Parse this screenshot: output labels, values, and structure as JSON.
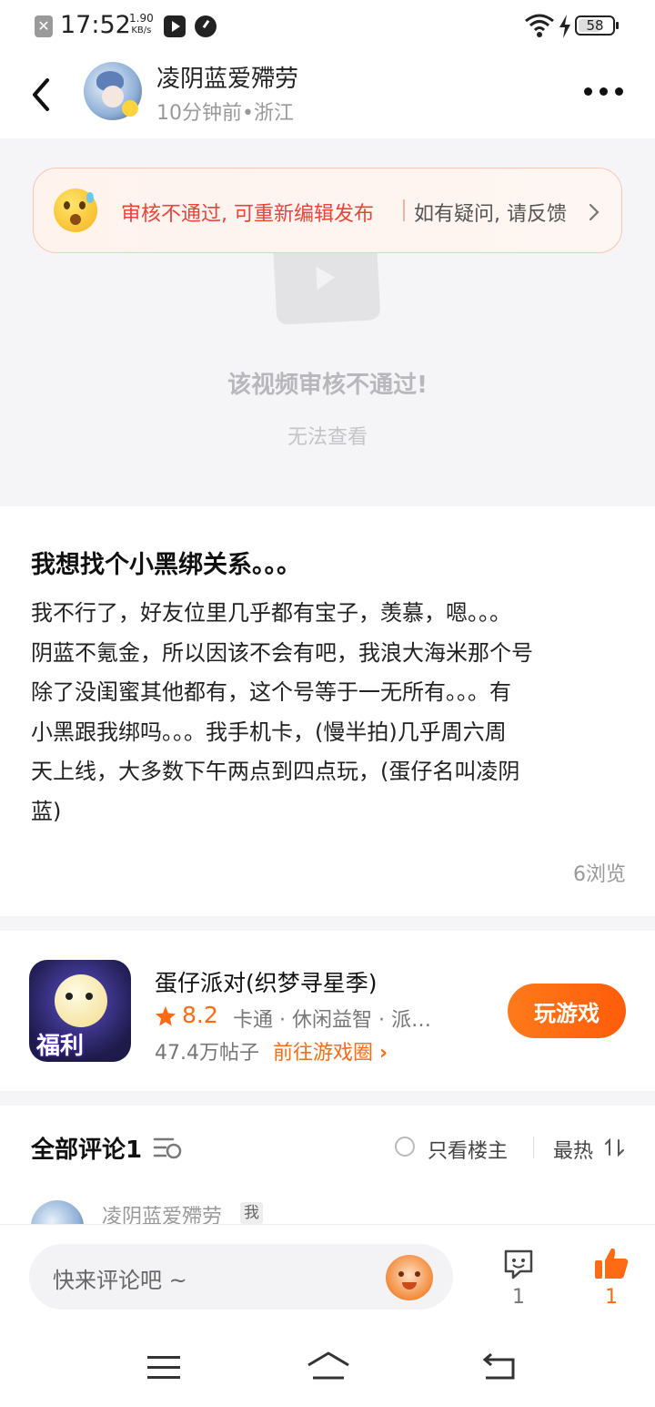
{
  "status_bar": {
    "time": "17:52",
    "speed_value": "1.90",
    "speed_unit": "KB/s",
    "battery": "58"
  },
  "header": {
    "username": "凌阴蓝爱殢劳",
    "meta": "10分钟前•浙江"
  },
  "audit_banner": {
    "message": "审核不通过, 可重新编辑发布",
    "feedback": "如有疑问, 请反馈"
  },
  "video": {
    "status_title": "该视频审核不通过!",
    "status_sub": "无法查看"
  },
  "post": {
    "title": "我想找个小黑绑关系。。。",
    "body_lines": [
      "我不行了，好友位里几乎都有宝子，羡慕，嗯。。。",
      "阴蓝不氪金，所以因该不会有吧，我浪大海米那个号",
      "除了没闺蜜其他都有，这个号等于一无所有。。。有",
      "小黑跟我绑吗。。。我手机卡，(慢半拍)几乎周六周",
      "天上线，大多数下午两点到四点玩，(蛋仔名叫凌阴",
      "蓝)"
    ],
    "views": "6浏览"
  },
  "game_card": {
    "name": "蛋仔派对(织梦寻星季)",
    "rating": "8.2",
    "tags": "卡通 · 休闲益智 · 派…",
    "posts": "47.4万帖子",
    "circle_link": "前往游戏圈",
    "badge": "福利",
    "play_button": "玩游戏"
  },
  "comments": {
    "title": "全部评论1",
    "only_author": "只看楼主",
    "sort": "最热",
    "first_user": "凌阴蓝爱殢劳",
    "me_tag": "我"
  },
  "bottom_bar": {
    "placeholder": "快来评论吧 ~",
    "comment_count": "1",
    "like_count": "1"
  },
  "colors": {
    "accent": "#ff6a14",
    "warning_text": "#e8443a",
    "muted": "#999999"
  }
}
